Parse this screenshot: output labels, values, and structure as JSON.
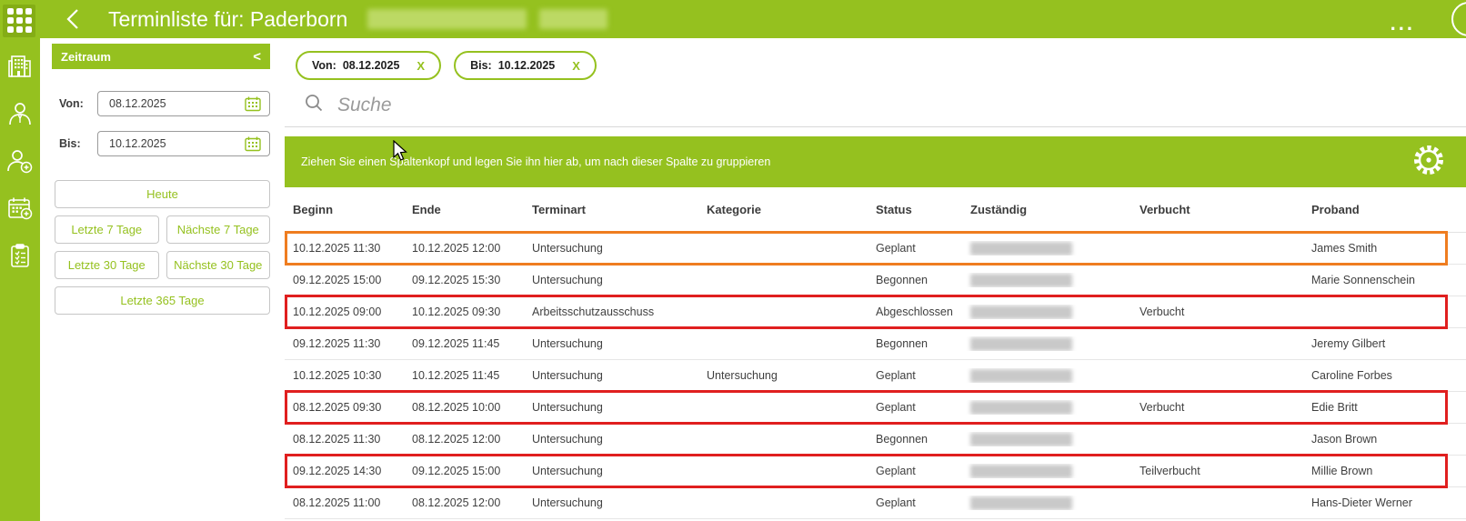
{
  "colors": {
    "brand_green": "#95c11f",
    "brand_green_dark": "#84ad15",
    "highlight_red": "#e01f1f",
    "highlight_orange": "#ef7d20"
  },
  "topbar": {
    "title": "Terminliste für: Paderborn",
    "back_icon": "‹",
    "more_label": "...",
    "app_grid_icon": "grid-3x3"
  },
  "nav": {
    "items": [
      {
        "icon": "building"
      },
      {
        "icon": "user"
      },
      {
        "icon": "user-add"
      },
      {
        "icon": "calendar-add"
      },
      {
        "icon": "checklist"
      }
    ]
  },
  "filter_panel": {
    "title": "Zeitraum",
    "collapse_icon": "<",
    "von_label": "Von:",
    "von_value": "08.12.2025",
    "bis_label": "Bis:",
    "bis_value": "10.12.2025",
    "buttons": [
      "Heute",
      "Letzte 7 Tage",
      "Nächste 7 Tage",
      "Letzte 30 Tage",
      "Nächste 30 Tage",
      "Letzte 365 Tage"
    ]
  },
  "chips": [
    {
      "label": "Von:",
      "value": "08.12.2025",
      "remove_icon": "X"
    },
    {
      "label": "Bis:",
      "value": "10.12.2025",
      "remove_icon": "X"
    }
  ],
  "search": {
    "placeholder": "Suche"
  },
  "groupbar": {
    "text": "Ziehen Sie einen Spaltenkopf und legen Sie ihn hier ab, um nach dieser Spalte zu gruppieren",
    "settings_icon": "gear"
  },
  "table": {
    "columns": [
      "Beginn",
      "Ende",
      "Terminart",
      "Kategorie",
      "Status",
      "Zuständig",
      "Verbucht",
      "Proband"
    ],
    "rows": [
      {
        "beginn": "10.12.2025 11:30",
        "ende": "10.12.2025 12:00",
        "terminart": "Untersuchung",
        "kategorie": "",
        "status": "Geplant",
        "zustaendig_redacted": true,
        "verbucht": "",
        "proband": "James Smith",
        "highlight": "orange"
      },
      {
        "beginn": "09.12.2025 15:00",
        "ende": "09.12.2025 15:30",
        "terminart": "Untersuchung",
        "kategorie": "",
        "status": "Begonnen",
        "zustaendig_redacted": true,
        "verbucht": "",
        "proband": "Marie Sonnenschein",
        "highlight": ""
      },
      {
        "beginn": "10.12.2025 09:00",
        "ende": "10.12.2025 09:30",
        "terminart": "Arbeitsschutzausschuss",
        "kategorie": "",
        "status": "Abgeschlossen",
        "zustaendig_redacted": true,
        "verbucht": "Verbucht",
        "proband": "",
        "highlight": "red"
      },
      {
        "beginn": "09.12.2025 11:30",
        "ende": "09.12.2025 11:45",
        "terminart": "Untersuchung",
        "kategorie": "",
        "status": "Begonnen",
        "zustaendig_redacted": true,
        "verbucht": "",
        "proband": "Jeremy Gilbert",
        "highlight": ""
      },
      {
        "beginn": "10.12.2025 10:30",
        "ende": "10.12.2025 11:45",
        "terminart": "Untersuchung",
        "kategorie": "Untersuchung",
        "status": "Geplant",
        "zustaendig_redacted": true,
        "verbucht": "",
        "proband": "Caroline Forbes",
        "highlight": ""
      },
      {
        "beginn": "08.12.2025 09:30",
        "ende": "08.12.2025 10:00",
        "terminart": "Untersuchung",
        "kategorie": "",
        "status": "Geplant",
        "zustaendig_redacted": true,
        "verbucht": "Verbucht",
        "proband": "Edie Britt",
        "highlight": "red"
      },
      {
        "beginn": "08.12.2025 11:30",
        "ende": "08.12.2025 12:00",
        "terminart": "Untersuchung",
        "kategorie": "",
        "status": "Begonnen",
        "zustaendig_redacted": true,
        "verbucht": "",
        "proband": "Jason Brown",
        "highlight": ""
      },
      {
        "beginn": "09.12.2025 14:30",
        "ende": "09.12.2025 15:00",
        "terminart": "Untersuchung",
        "kategorie": "",
        "status": "Geplant",
        "zustaendig_redacted": true,
        "verbucht": "Teilverbucht",
        "proband": "Millie Brown",
        "highlight": "red"
      },
      {
        "beginn": "08.12.2025 11:00",
        "ende": "08.12.2025 12:00",
        "terminart": "Untersuchung",
        "kategorie": "",
        "status": "Geplant",
        "zustaendig_redacted": true,
        "verbucht": "",
        "proband": "Hans-Dieter Werner",
        "highlight": ""
      }
    ]
  }
}
